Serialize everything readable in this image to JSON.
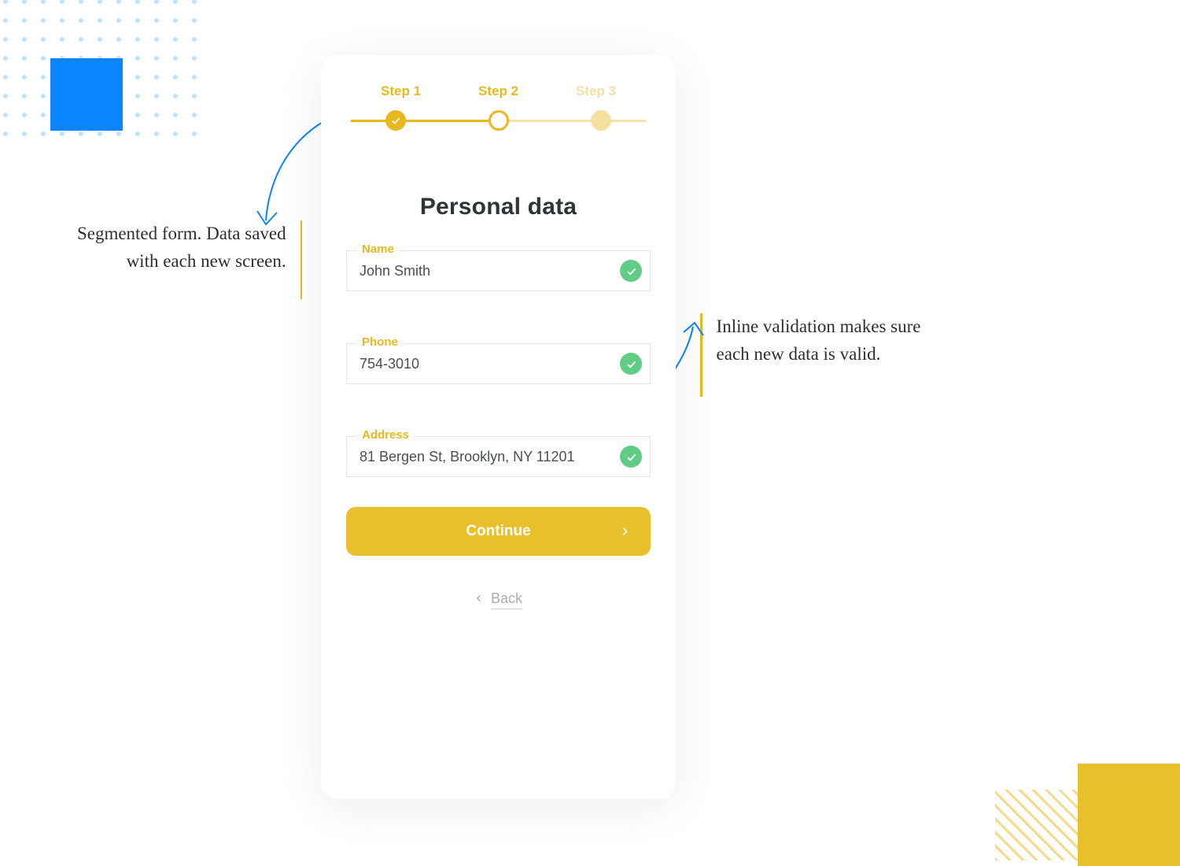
{
  "stepper": {
    "steps": [
      {
        "label": "Step 1"
      },
      {
        "label": "Step 2"
      },
      {
        "label": "Step 3"
      }
    ]
  },
  "form": {
    "title": "Personal data",
    "fields": {
      "name": {
        "label": "Name",
        "value": "John Smith"
      },
      "phone": {
        "label": "Phone",
        "value": "754-3010"
      },
      "address": {
        "label": "Address",
        "value": "81 Bergen St, Brooklyn, NY 11201"
      }
    },
    "continue_label": "Continue",
    "back_label": "Back"
  },
  "annotations": {
    "left": "Segmented form. Data saved with each new screen.",
    "right": "Inline validation makes sure each new data is valid."
  }
}
